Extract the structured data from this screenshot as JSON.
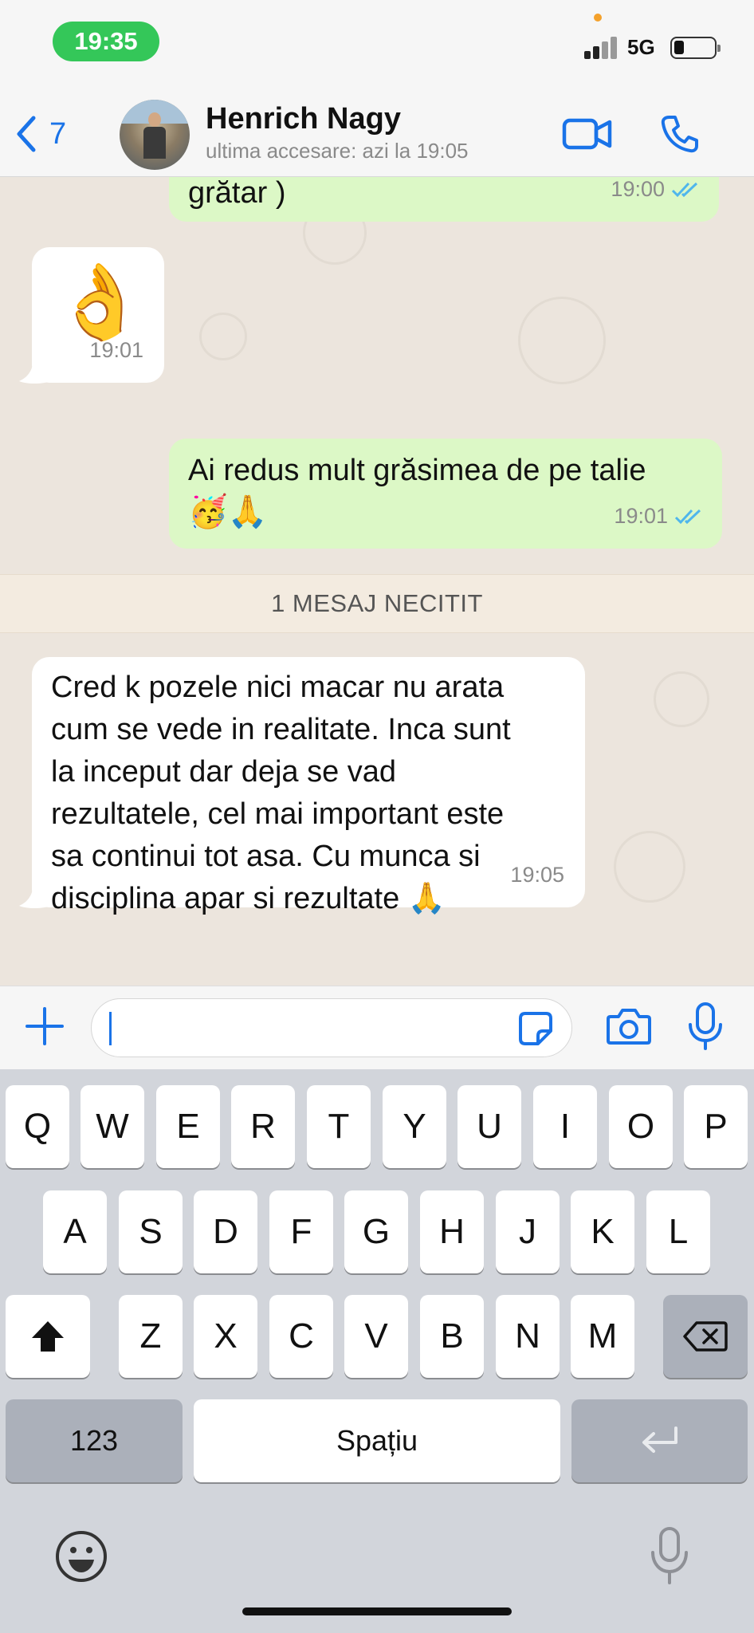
{
  "status_bar": {
    "time": "19:35",
    "network": "5G"
  },
  "header": {
    "back_count": "7",
    "contact_name": "Henrich Nagy",
    "last_seen": "ultima accesare: azi la 19:05"
  },
  "messages": [
    {
      "direction": "outgoing",
      "text": "grătar )",
      "time": "19:00",
      "read": true
    },
    {
      "direction": "incoming",
      "emoji": "👌",
      "time": "19:01"
    },
    {
      "direction": "outgoing",
      "text": "Ai redus mult grăsimea de pe talie",
      "emoji": "🥳🙏",
      "time": "19:01",
      "read": true
    },
    {
      "direction": "incoming",
      "text_lines": [
        "Cred k pozele nici macar nu arata",
        "cum se vede in realitate. Inca sunt",
        "la inceput dar deja se vad",
        "rezultatele, cel mai important este",
        "sa continui tot asa. Cu munca si",
        "disciplina apar si rezultate 🙏"
      ],
      "time": "19:05"
    }
  ],
  "unread_banner": "1 MESAJ NECITIT",
  "input": {
    "value": ""
  },
  "keyboard": {
    "row1": [
      "Q",
      "W",
      "E",
      "R",
      "T",
      "Y",
      "U",
      "I",
      "O",
      "P"
    ],
    "row2": [
      "A",
      "S",
      "D",
      "F",
      "G",
      "H",
      "J",
      "K",
      "L"
    ],
    "row3": [
      "Z",
      "X",
      "C",
      "V",
      "B",
      "N",
      "M"
    ],
    "numbers_label": "123",
    "space_label": "Spațiu"
  },
  "colors": {
    "accent": "#1a73e8",
    "outgoing_bubble": "#dcf8c6",
    "online_pill": "#34c759",
    "read_ticks": "#4fb6ec"
  }
}
